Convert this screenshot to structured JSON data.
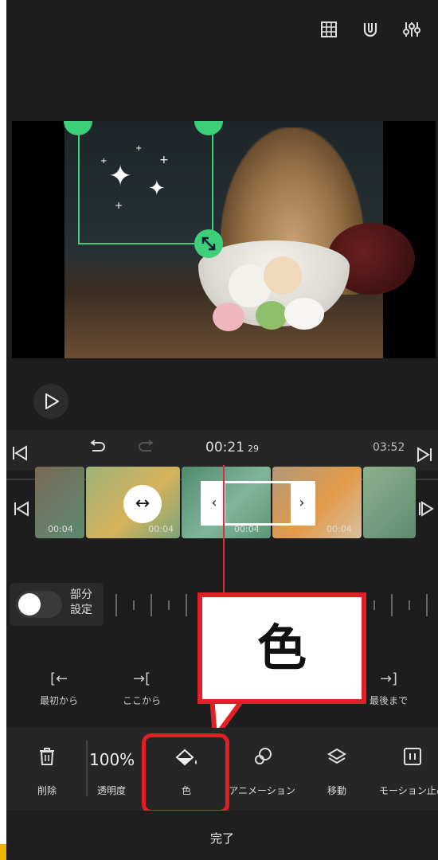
{
  "colors": {
    "accent_green": "#3ecf7a",
    "playhead": "#e22a3a",
    "callout_red": "#e21f26"
  },
  "top_bar": {
    "icons": [
      "grid-icon",
      "magnet-icon",
      "sliders-icon"
    ]
  },
  "timeline": {
    "current_time": "00:21",
    "current_frame": "29",
    "total_time": "03:52"
  },
  "clips": {
    "durations": [
      "00:04",
      "00:04",
      "00:04",
      "00:04"
    ]
  },
  "partial_setting": {
    "label_line1": "部分",
    "label_line2": "設定",
    "enabled": false
  },
  "split_actions": {
    "from_start": "最初から",
    "from_here": "ここから",
    "to_end": "最後まで"
  },
  "callout": {
    "text": "色"
  },
  "toolbar": {
    "delete": "削除",
    "opacity_value": "100%",
    "opacity": "透明度",
    "color": "色",
    "animation": "アニメーション",
    "move": "移動",
    "motion_stop": "モーション止め"
  },
  "done_label": "完了"
}
